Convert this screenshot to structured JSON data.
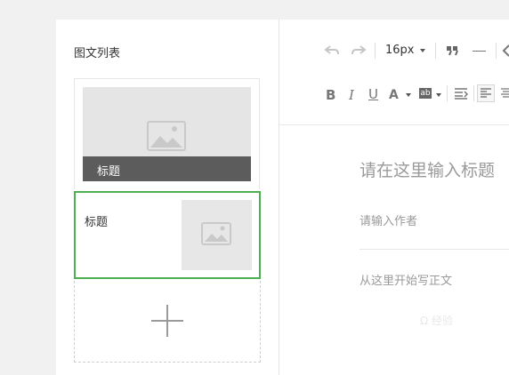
{
  "list": {
    "title": "图文列表",
    "items": [
      {
        "title": "标题"
      },
      {
        "title": "标题"
      }
    ]
  },
  "editor": {
    "font_size": "16px",
    "title_placeholder": "请在这里输入标题",
    "author_placeholder": "请输入作者",
    "body_placeholder": "从这里开始写正文",
    "toolbar_icons": [
      "undo-icon",
      "redo-icon",
      "font-size-select",
      "quote-icon",
      "hr-icon",
      "link-icon",
      "bold-icon",
      "italic-icon",
      "underline-icon",
      "font-color-icon",
      "background-color-icon",
      "indent-icon",
      "align-left-icon",
      "align-center-icon"
    ]
  },
  "watermark": "Ω 经验"
}
